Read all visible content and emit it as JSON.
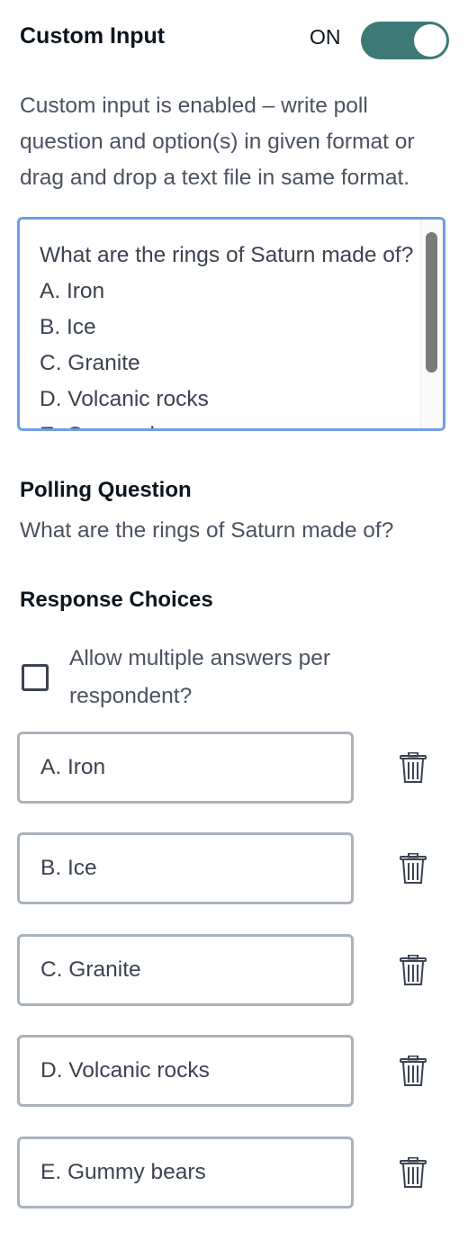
{
  "header": {
    "title": "Custom Input",
    "toggle_label": "ON"
  },
  "description": "Custom input is enabled – write poll question and option(s) in given format or drag and drop a text file in same format.",
  "textarea": {
    "value": "What are the rings of Saturn made of?\nA. Iron\nB. Ice\nC. Granite\nD. Volcanic rocks\nE. Gummy bears"
  },
  "polling": {
    "title": "Polling Question",
    "question": "What are the rings of Saturn made of?"
  },
  "responses": {
    "title": "Response Choices",
    "allow_multiple_label": "Allow multiple answers per respondent?",
    "choices": [
      {
        "label": "A. Iron"
      },
      {
        "label": "B. Ice"
      },
      {
        "label": "C. Granite"
      },
      {
        "label": "D. Volcanic rocks"
      },
      {
        "label": "E. Gummy bears"
      }
    ]
  },
  "icons": {
    "delete": "trash-icon"
  },
  "colors": {
    "toggle_on": "#3d7a76",
    "focus_border": "#6f9ee8"
  }
}
